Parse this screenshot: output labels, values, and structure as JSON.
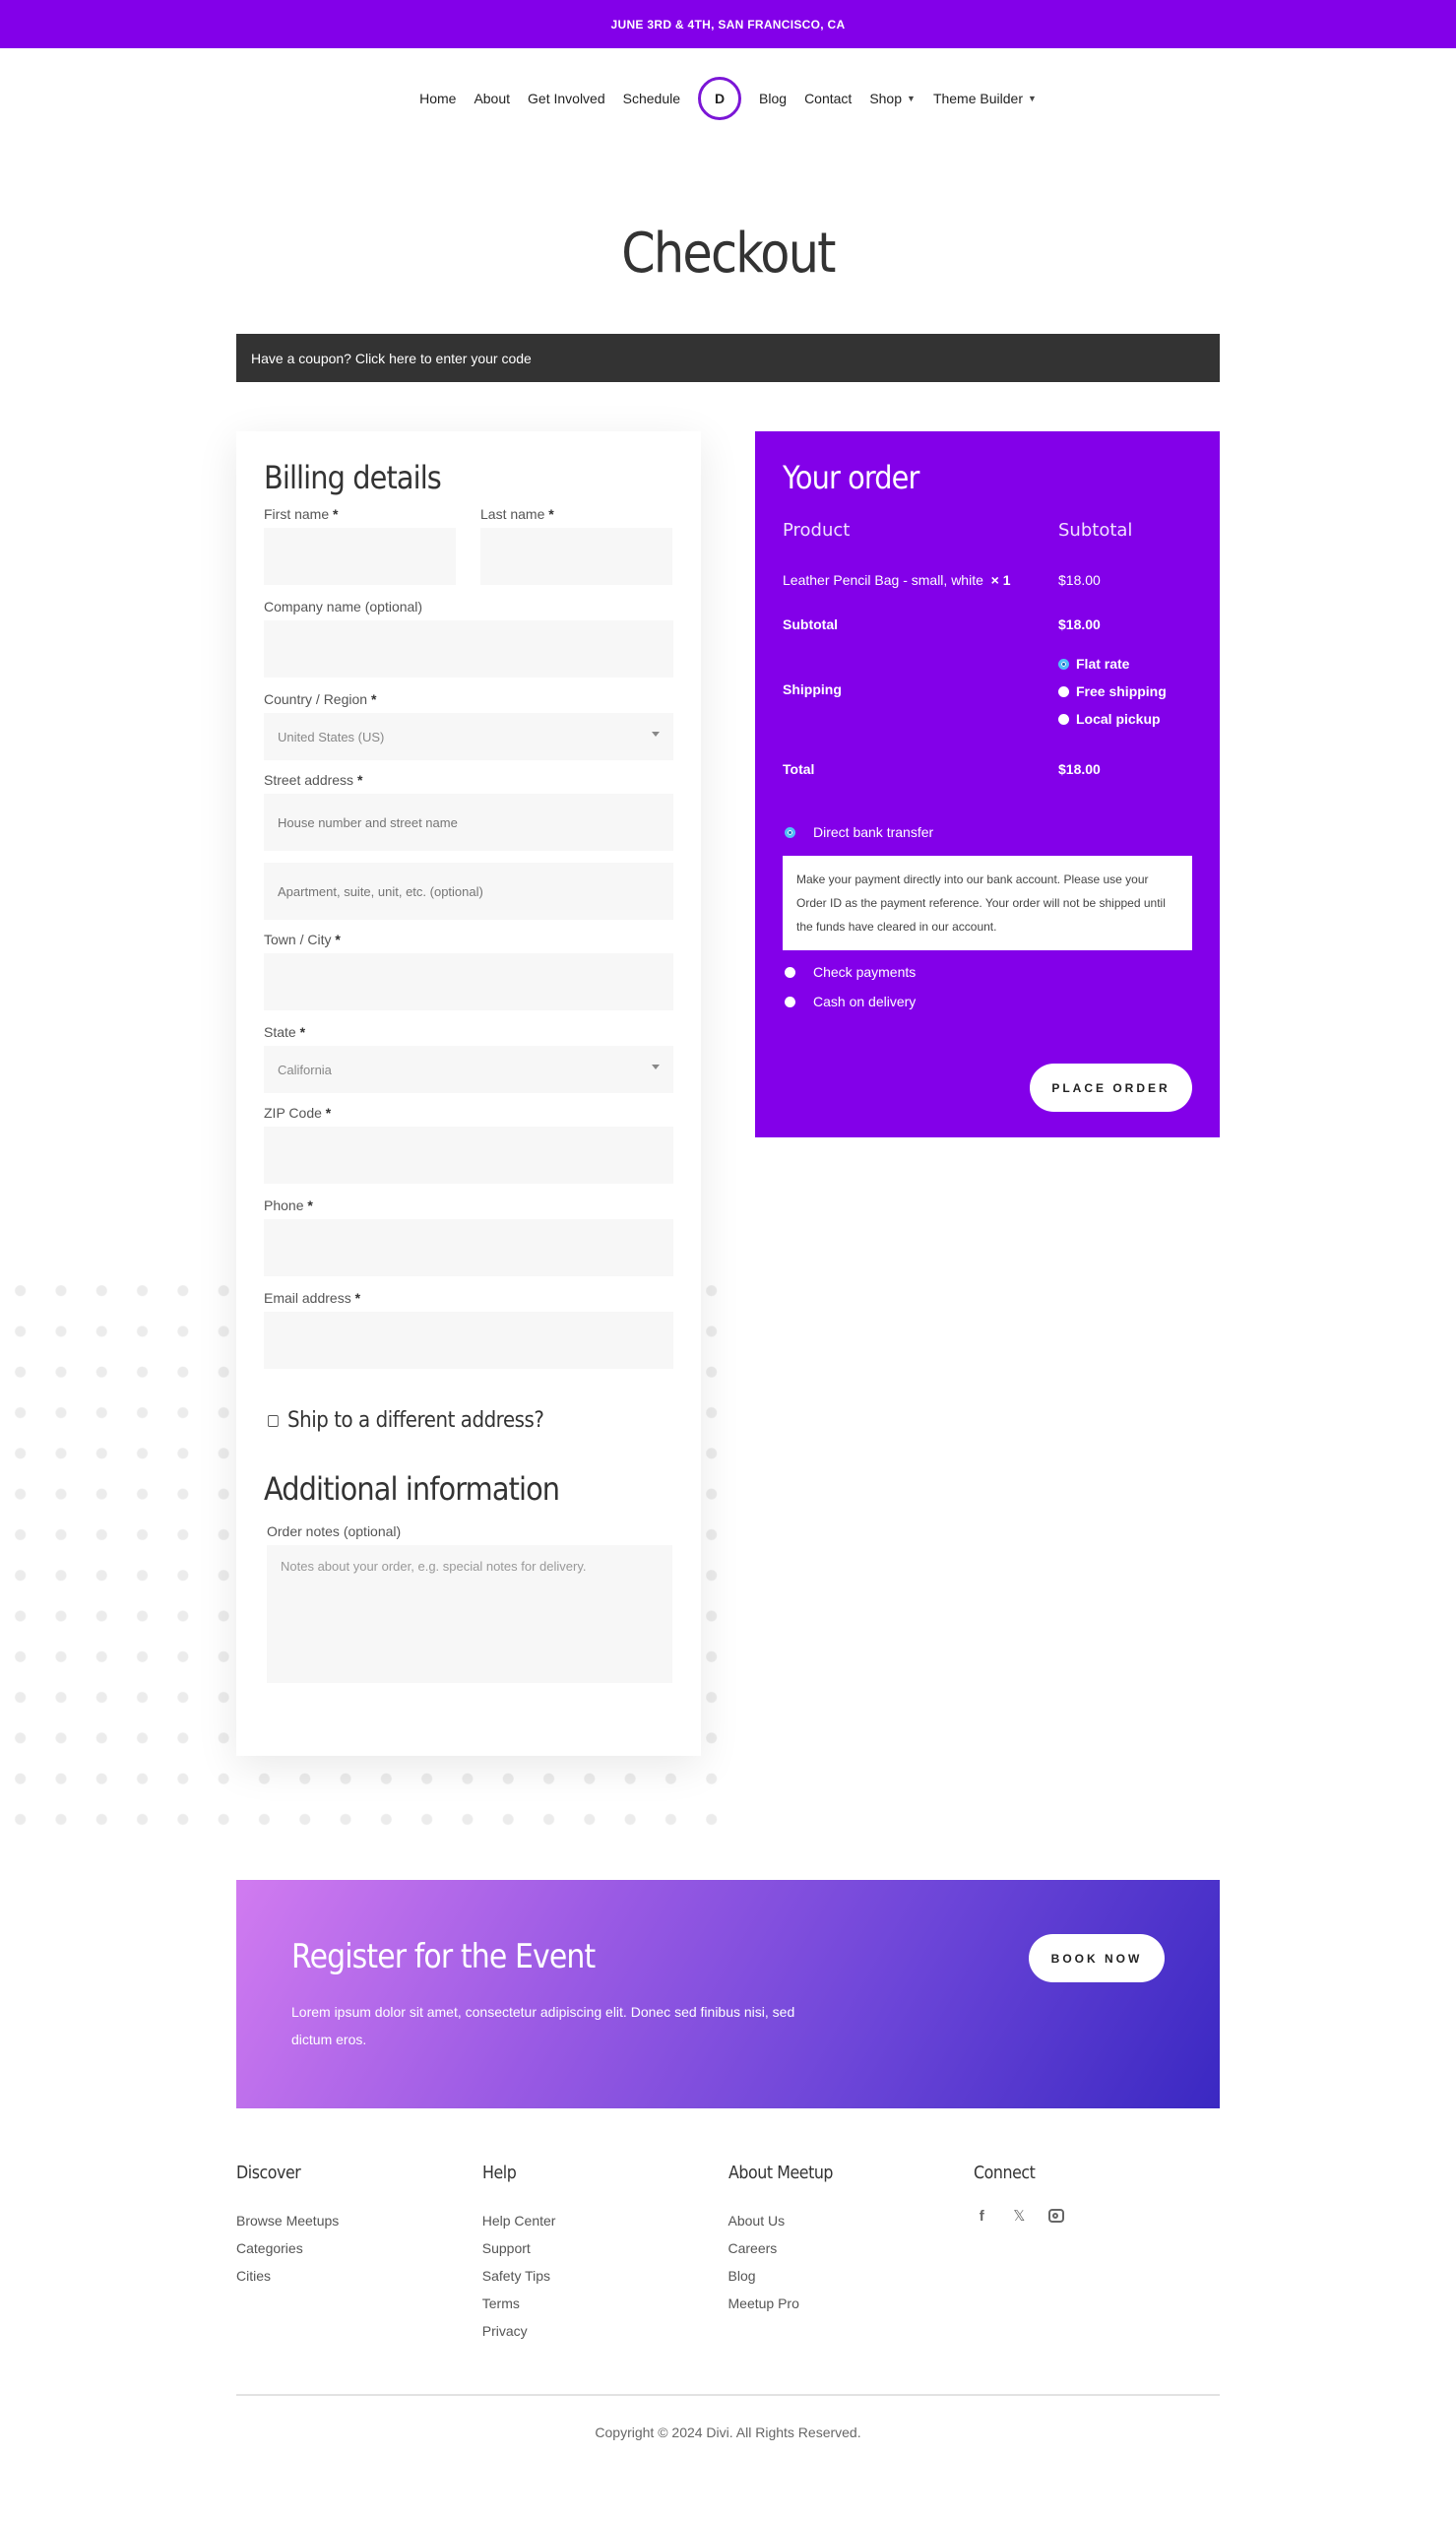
{
  "topbar": {
    "text": "JUNE 3RD & 4TH, SAN FRANCISCO, CA"
  },
  "nav": {
    "left": [
      {
        "label": "Home"
      },
      {
        "label": "About"
      },
      {
        "label": "Get Involved"
      },
      {
        "label": "Schedule"
      }
    ],
    "logo": {
      "letter": "D",
      "icon": "divi-logo-icon"
    },
    "right": [
      {
        "label": "Blog"
      },
      {
        "label": "Contact"
      },
      {
        "label": "Shop",
        "has_dropdown": true
      },
      {
        "label": "Theme Builder",
        "has_dropdown": true
      }
    ],
    "chevron": "⌄"
  },
  "page": {
    "title": "Checkout"
  },
  "coupon": {
    "text": "Have a coupon? Click here to enter your code"
  },
  "billing": {
    "title": "Billing details",
    "required_mark": "*",
    "fields": {
      "first_name": {
        "label": "First name",
        "value": ""
      },
      "last_name": {
        "label": "Last name",
        "value": ""
      },
      "company": {
        "label": "Company name (optional)",
        "value": ""
      },
      "country": {
        "label": "Country / Region",
        "value": "United States (US)"
      },
      "street": {
        "label": "Street address",
        "placeholder": "House number and street name",
        "placeholder2": "Apartment, suite, unit, etc. (optional)"
      },
      "city": {
        "label": "Town / City",
        "value": ""
      },
      "state": {
        "label": "State",
        "value": "California"
      },
      "zip": {
        "label": "ZIP Code",
        "value": ""
      },
      "phone": {
        "label": "Phone",
        "value": ""
      },
      "email": {
        "label": "Email address",
        "value": ""
      }
    },
    "ship_different": {
      "label": "Ship to a different address?",
      "checked": false
    },
    "additional": {
      "title": "Additional information",
      "notes_label": "Order notes (optional)",
      "notes_placeholder": "Notes about your order, e.g. special notes for delivery."
    }
  },
  "order": {
    "title": "Your order",
    "headers": {
      "product": "Product",
      "subtotal": "Subtotal"
    },
    "items": [
      {
        "name": "Leather Pencil Bag - small, white",
        "qty": "× 1",
        "subtotal": "$18.00"
      }
    ],
    "subtotal": {
      "label": "Subtotal",
      "value": "$18.00"
    },
    "shipping": {
      "label": "Shipping",
      "options": [
        {
          "label": "Flat rate",
          "selected": true
        },
        {
          "label": "Free shipping",
          "selected": false
        },
        {
          "label": "Local pickup",
          "selected": false
        }
      ]
    },
    "total": {
      "label": "Total",
      "value": "$18.00"
    },
    "payment": {
      "methods": [
        {
          "label": "Direct bank transfer",
          "selected": true
        },
        {
          "label": "Check payments",
          "selected": false
        },
        {
          "label": "Cash on delivery",
          "selected": false
        }
      ],
      "description": "Make your payment directly into our bank account. Please use your Order ID as the payment reference. Your order will not be shipped until the funds have cleared in our account."
    },
    "place_order_label": "PLACE ORDER"
  },
  "cta": {
    "title": "Register for the Event",
    "body": "Lorem ipsum dolor sit amet, consectetur adipiscing elit. Donec sed finibus nisi, sed dictum eros.",
    "button": "BOOK NOW"
  },
  "footer": {
    "columns": [
      {
        "title": "Discover",
        "links": [
          "Browse Meetups",
          "Categories",
          "Cities"
        ]
      },
      {
        "title": "Help",
        "links": [
          "Help Center",
          "Support",
          "Safety Tips",
          "Terms",
          "Privacy"
        ]
      },
      {
        "title": "About Meetup",
        "links": [
          "About Us",
          "Careers",
          "Blog",
          "Meetup Pro"
        ]
      },
      {
        "title": "Connect",
        "social": [
          "facebook-icon",
          "x-twitter-icon",
          "instagram-icon"
        ]
      }
    ],
    "social_glyphs": {
      "facebook": "f",
      "x": "𝕏"
    },
    "copyright": "Copyright © 2024 Divi. All Rights Reserved."
  },
  "colors": {
    "brand_purple": "#8300e9",
    "coupon_bg": "#333333",
    "input_bg": "#f7f7f7",
    "cta_gradient_start": "#d17bf0",
    "cta_gradient_end": "#3a28c2"
  }
}
